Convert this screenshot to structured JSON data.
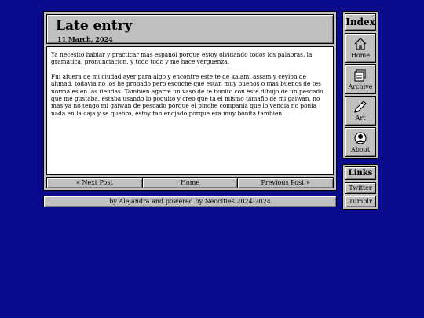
{
  "post": {
    "title": "Late entry",
    "date": "11 March, 2024",
    "paragraphs": [
      "Ya necesito hablar y practicar mas espanol porque estoy olvidando todos los palabras, la gramatica, pronunciacion, y todo todo y me hace verguenza.",
      "Fui afuera de mi ciudad ayer para algo y encontre este te de kalami assam y ceylon de ahmad, todavia no los he probado pero escuche que estan muy buenos o mas buenos de tes normales en las tiendas. Tambien agarre un vaso de te bonito con este dibujo de un pescado que me gustaba, estaba usando lo poquito y creo que ta el mismo tamaño de mi gaiwan, no mas ya no tengo mi gaiwan de pescado porque el pinche compania que lo vendia no ponia nada en la caja y se quebro, estoy tan enojado porque era muy bonita tambien."
    ]
  },
  "nav": {
    "next": "« Next Post",
    "home": "Home",
    "previous": "Previous Post »"
  },
  "footer": {
    "text": "by Alejandra and powered by Neocities 2024-2024"
  },
  "sidebar": {
    "title": "Index",
    "items": [
      {
        "label": "Home",
        "icon": "home-icon"
      },
      {
        "label": "Archive",
        "icon": "archive-icon"
      },
      {
        "label": "Art",
        "icon": "pencil-icon"
      },
      {
        "label": "About",
        "icon": "person-icon"
      }
    ]
  },
  "links": {
    "title": "Links",
    "items": [
      {
        "label": "Twitter"
      },
      {
        "label": "Tumblr"
      }
    ]
  },
  "colors": {
    "background": "#0a0a8c",
    "panel": "#c0c0c0",
    "content": "#ffffff"
  }
}
